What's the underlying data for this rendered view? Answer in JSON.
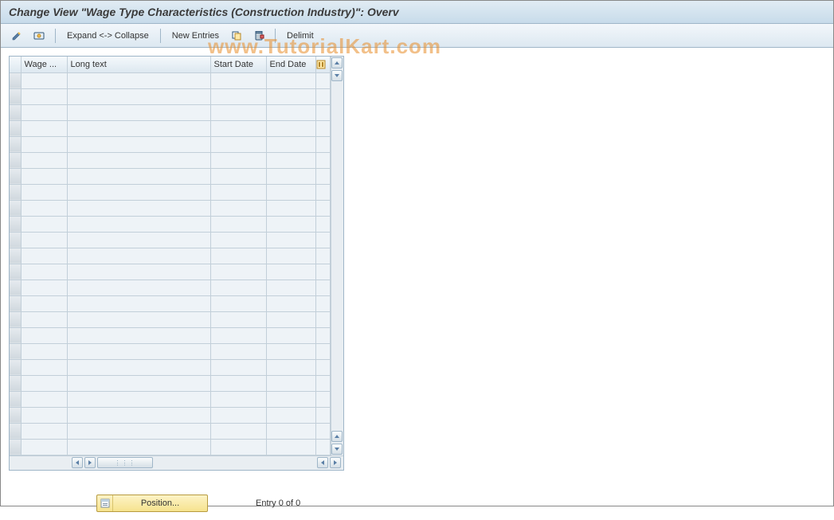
{
  "title": "Change View \"Wage Type Characteristics (Construction Industry)\": Overv",
  "toolbar": {
    "expand_collapse": "Expand <-> Collapse",
    "new_entries": "New Entries",
    "delimit": "Delimit"
  },
  "table": {
    "columns": {
      "wage": "Wage ...",
      "long_text": "Long text",
      "start_date": "Start Date",
      "end_date": "End Date"
    },
    "row_count": 24
  },
  "footer": {
    "position_label": "Position...",
    "entry_text": "Entry 0 of 0"
  },
  "watermark": "www.TutorialKart.com"
}
